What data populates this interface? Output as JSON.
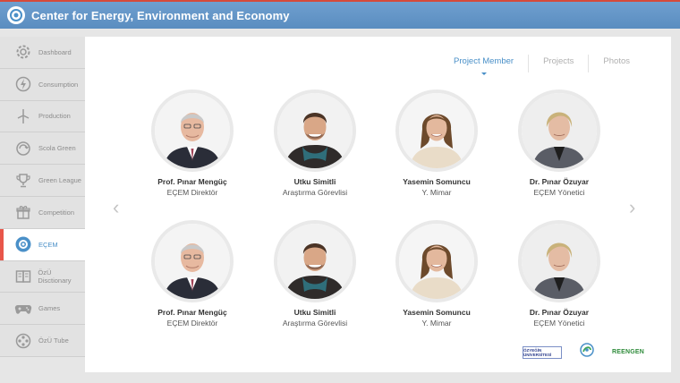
{
  "app": {
    "title": "Center for Energy, Environment and Economy"
  },
  "sidebar": {
    "items": [
      {
        "label": "Dashboard",
        "icon": "gear-icon",
        "active": false
      },
      {
        "label": "Consumption",
        "icon": "lightning-icon",
        "active": false
      },
      {
        "label": "Production",
        "icon": "wind-turbine-icon",
        "active": false
      },
      {
        "label": "Scola Green",
        "icon": "recycle-icon",
        "active": false
      },
      {
        "label": "Green League",
        "icon": "trophy-icon",
        "active": false
      },
      {
        "label": "Competition",
        "icon": "gift-icon",
        "active": false
      },
      {
        "label": "EÇEM",
        "icon": "eçem-logo-icon",
        "active": true
      },
      {
        "label": "ÖzÜ Disctionary",
        "icon": "book-icon",
        "active": false
      },
      {
        "label": "Games",
        "icon": "gamepad-icon",
        "active": false
      },
      {
        "label": "ÖzÜ Tube",
        "icon": "film-reel-icon",
        "active": false
      }
    ]
  },
  "tabs": [
    {
      "label": "Project Member",
      "active": true
    },
    {
      "label": "Projects",
      "active": false
    },
    {
      "label": "Photos",
      "active": false
    }
  ],
  "members": [
    {
      "name": "Prof. Pınar Mengüç",
      "role": "EÇEM Direktör"
    },
    {
      "name": "Utku Simitli",
      "role": "Araştırma Görevlisi"
    },
    {
      "name": "Yasemin Somuncu",
      "role": "Y. Mimar"
    },
    {
      "name": "Dr. Pınar Özuyar",
      "role": "EÇEM Yönetici"
    },
    {
      "name": "Prof. Pınar Mengüç",
      "role": "EÇEM Direktör"
    },
    {
      "name": "Utku Simitli",
      "role": "Araştırma Görevlisi"
    },
    {
      "name": "Yasemin Somuncu",
      "role": "Y. Mimar"
    },
    {
      "name": "Dr. Pınar Özuyar",
      "role": "EÇEM Yönetici"
    }
  ],
  "nav": {
    "prev": "‹",
    "next": "›"
  },
  "footer_logos": {
    "ozyegin": "ÖZYEĞİN ÜNİVERSİTESİ",
    "reengen": "REENGEN"
  },
  "colors": {
    "header": "#5f92c4",
    "accent": "#4a90c8",
    "active_marker": "#e8564a"
  }
}
